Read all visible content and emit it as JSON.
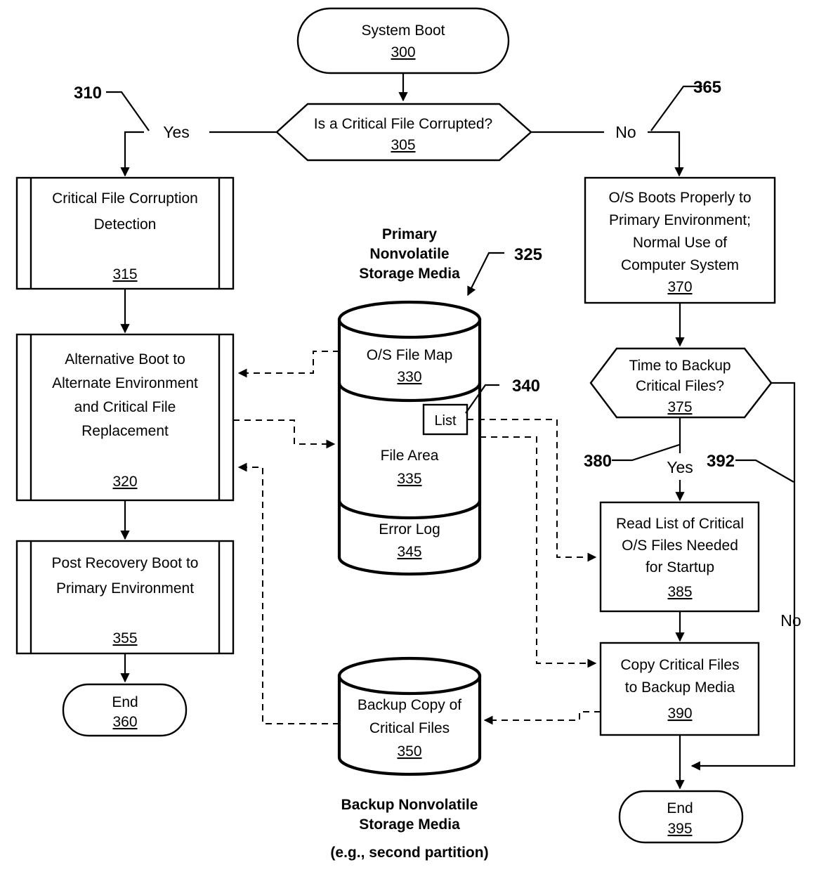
{
  "figure": {
    "title": "Critical File Corruption Recovery and Backup Flowchart",
    "type": "patent-flowchart"
  },
  "nodes": {
    "start": {
      "label": "System Boot",
      "ref": "300",
      "shape": "terminator"
    },
    "decision_corrupt": {
      "label": "Is a Critical File Corrupted?",
      "ref": "305",
      "shape": "hexagon"
    },
    "detection": {
      "line1": "Critical File Corruption",
      "line2": "Detection",
      "ref": "315",
      "shape": "process-bars"
    },
    "alt_boot": {
      "line1": "Alternative Boot to",
      "line2": "Alternate Environment",
      "line3": "and Critical File",
      "line4": "Replacement",
      "ref": "320",
      "shape": "process-bars"
    },
    "post_recovery": {
      "line1": "Post Recovery Boot to",
      "line2": "Primary Environment",
      "ref": "355",
      "shape": "process-bars"
    },
    "end_left": {
      "label": "End",
      "ref": "360",
      "shape": "terminator"
    },
    "os_boots": {
      "line1": "O/S Boots Properly to",
      "line2": "Primary Environment;",
      "line3": "Normal Use of",
      "line4": "Computer System",
      "ref": "370",
      "shape": "process"
    },
    "decision_backup": {
      "line1": "Time to Backup",
      "line2": "Critical Files?",
      "ref": "375",
      "shape": "hexagon"
    },
    "read_list": {
      "line1": "Read List of Critical",
      "line2": "O/S Files Needed",
      "line3": "for Startup",
      "ref": "385",
      "shape": "process"
    },
    "copy_files": {
      "line1": "Copy Critical Files",
      "line2": "to Backup Media",
      "ref": "390",
      "shape": "process"
    },
    "end_right": {
      "label": "End",
      "ref": "395",
      "shape": "terminator"
    }
  },
  "storage": {
    "primary": {
      "caption_line1": "Primary",
      "caption_line2": "Nonvolatile",
      "caption_line3": "Storage Media",
      "callout": "325",
      "segments": [
        {
          "label": "O/S File Map",
          "ref": "330"
        },
        {
          "label": "File Area",
          "ref": "335"
        },
        {
          "label": "Error Log",
          "ref": "345"
        }
      ],
      "list_box": {
        "label": "List",
        "callout": "340"
      }
    },
    "backup": {
      "label_line1": "Backup Copy of",
      "label_line2": "Critical Files",
      "ref": "350",
      "caption_line1": "Backup Nonvolatile",
      "caption_line2": "Storage Media",
      "caption_line3": "(e.g., second partition)"
    }
  },
  "branches": {
    "yes_left": {
      "label": "Yes",
      "callout": "310"
    },
    "no_right": {
      "label": "No",
      "callout": "365"
    },
    "yes_backup": {
      "label": "Yes",
      "callout": "380"
    },
    "no_backup": {
      "label": "No",
      "callout": "392"
    }
  },
  "colors": {
    "stroke": "#000000",
    "fill": "#ffffff",
    "background": "#ffffff"
  }
}
